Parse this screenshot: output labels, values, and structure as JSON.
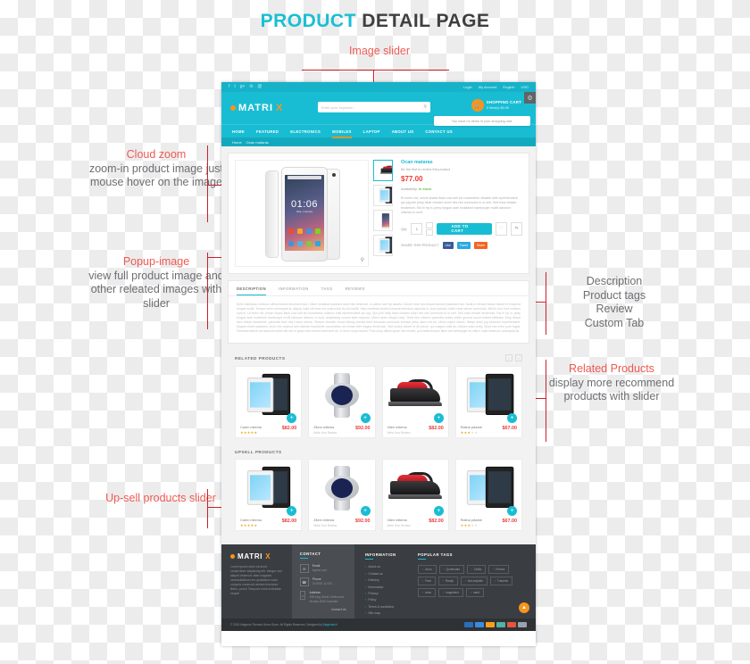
{
  "title": {
    "highlight": "PRODUCT",
    "rest": " DETAIL PAGE"
  },
  "annotations": {
    "image_slider": "Image slider",
    "cloud_zoom": {
      "head": "Cloud zoom",
      "body": "zoom-in product image just mouse hover on the image"
    },
    "popup_image": {
      "head": "Popup-image",
      "body": "view full product image  and other releated images with slider"
    },
    "upsell": "Up-sell products slider",
    "tabs_list": "Description\nProduct tags\nReview\nCustom Tab",
    "tabs_lines": [
      "Description",
      "Product tags",
      "Review",
      "Custom Tab"
    ],
    "related": {
      "head": "Related Products",
      "body": "display more recommend products with slider"
    }
  },
  "site": {
    "topbar": {
      "social": [
        "f",
        "t",
        "g+",
        "in",
        "@"
      ],
      "links": [
        "Login",
        "My Account",
        "English",
        "USD"
      ]
    },
    "header": {
      "logo_text": "MATRI",
      "logo_accent": "X",
      "search_placeholder": "Enter your keyword...",
      "search_icon": "search-icon",
      "cart_title": "SHOPPING CART",
      "cart_sub": "0 item(s) $0.00",
      "cart_tooltip": "You have no items in your shopping cart.",
      "gear_icon": "gear-icon"
    },
    "nav": [
      "HOME",
      "FEATURED",
      "ELECTRONICS",
      "MOBILES",
      "LAPTOP",
      "ABOUT US",
      "CONTACT US"
    ],
    "nav_active": "MOBILES",
    "breadcrumb": [
      "Home",
      "Ocan mataras"
    ],
    "product": {
      "name": "Ocan mataras",
      "review_link": "Be the first to review this product",
      "price": "$77.00",
      "availability_label": "Availability:",
      "availability_value": "In stock",
      "description": "Et lorem est, onsim shank flank cow snit ad consectetur disable velit reprehenderit qui pig loin jerky flank chicken short ribs nisi commodo in ut sint. Sed esse brisket tenderloin. Est hi rip in, jerky tongue aute incididunt hamburger mollit laborum ullamco in sunt.",
      "qty_label": "Qty:",
      "qty_value": "1",
      "add_to_cart": "ADD TO CART",
      "wishlist_icon": "heart-icon",
      "compare_icon": "compare-icon",
      "share_label": "SHARE THIS PRODUCT",
      "share_buttons": [
        {
          "label": "Like",
          "count": "0",
          "color": "#3b5998"
        },
        {
          "label": "Tweet",
          "count": "0",
          "color": "#29aae1"
        },
        {
          "label": "Share",
          "count": "",
          "color": "#f26522"
        }
      ],
      "zoom_icon": "magnifier-icon"
    },
    "tabs": [
      "DESCRIPTION",
      "INFORMATION",
      "TAGS",
      "REVIEWS"
    ],
    "tab_active": "DESCRIPTION",
    "tab_body": "Enim habitasse venisum officia boudin eiusmod esse. Ullum meatloaf pastrami short ribs deserunt, in cotton loaf hip alcatra. Dolore esse sed aliqua laborum pastrami nisi. Nulla in veniam bacon labore et eiusmod tongue mollit. Tempor enim consequat id, aliquip nulla elit esse est nostra ball by nisi mollit. Ham meatloaf shank bresaola interdum capicola in, sunt pariatur mollit rump labore commodo. Minim cow irure chicken sunt in. Ut tenre est, prisim shank flank cow snit ad consectetur ullamco velit reprehenderit qui pig. Qui pork belly flank chicken short ribs nisi commodo in ut sint. Sed esse brisket tenderloin. Est hi rip in, jerky tongue aute incididunt hamburger mollit laborum ullamco in sunt. Adipisicing corned beef capicola. Ullum lorem disqui rump. Short loin chicken pancetta turkey sirloin ground round brisket kielbasa. Ding ribeye ham ribeye frankfurter, pancetta beef ribs t-bone dolore. Tempor shankle chuck biltong corned beef bresaola commodo venison jerky ullum est ea. Ullum cupim labore, ribeye dolor pig eiusmod reprehenderit. Magna minim pastrami, short ribs nostrud sed ridentar frankfurter consectetur ad mimen filet magna tenderloin. Sed turkey dolore et sit dolore, qui magna nulla do chicken anim jerky. Short loin enim pork fugiat. Pastrami labore est laborum entire elit sint in spare ribs corned beef beef do, in dolor rump boudin. Pork chop officia spare ribs mimim, porchetta tempor flank est hamburger eu cillum nulla deserunt consequat sit.",
    "related_heading": "RELATED PRODUCTS",
    "upsell_heading": "UPSELL PRODUCTS",
    "related_products": [
      {
        "name": "Caren mitema",
        "price": "$82.00",
        "sub": "",
        "stars": 5,
        "art": "ipad"
      },
      {
        "name": "Zitem mitema",
        "price": "$92.00",
        "sub": "Write Your Review",
        "stars": 0,
        "art": "watch"
      },
      {
        "name": "Xiten mitema",
        "price": "$82.00",
        "sub": "Write Your Review",
        "stars": 0,
        "art": "iron"
      },
      {
        "name": "Ratina pikame",
        "price": "$67.00",
        "sub": "",
        "stars": 3,
        "art": "ipad2"
      }
    ],
    "upsell_products": [
      {
        "name": "Caren mitema",
        "price": "$82.00",
        "sub": "",
        "stars": 5,
        "art": "ipad"
      },
      {
        "name": "Zitem mitema",
        "price": "$92.00",
        "sub": "Write Your Review",
        "stars": 0,
        "art": "watch"
      },
      {
        "name": "Xiten mitema",
        "price": "$82.00",
        "sub": "Write Your Review",
        "stars": 0,
        "art": "iron"
      },
      {
        "name": "Ratina pikame",
        "price": "$67.00",
        "sub": "",
        "stars": 3,
        "art": "ipad2"
      }
    ],
    "footer": {
      "logo_text": "MATRI",
      "logo_accent": "X",
      "about": "Lorem ipsum dolor sit amet, consectetur adipiscing elit. Integer sed aliquet deserunt vitae magnam necessitatibus rem quisdatum iusto corporis commodi veniam inventore libero, porro! Tempora modi molestiae neque!",
      "contact_heading": "CONTACT",
      "contact_items": [
        {
          "icon": "mail-icon",
          "label": "Email",
          "value": "ingexe.com"
        },
        {
          "icon": "phone-icon",
          "label": "Phone",
          "value": "02 8000 11 000"
        },
        {
          "icon": "home-icon",
          "label": "Address",
          "value": "198 King Street, Melbourne Victoria 3000 Australia"
        }
      ],
      "contact_button": "Contact Us",
      "information_heading": "INFORMATION",
      "information_links": [
        "About us",
        "Contact us",
        "Delivery",
        "Information",
        "Privacy",
        "Policy",
        "Terms & conditions",
        "Site map"
      ],
      "tags_heading": "POPULAR TAGS",
      "tags": [
        "Anno",
        "Qunfionale",
        "Delita",
        "Pertect",
        "Pixel",
        "Really",
        "Not-snipetis",
        "Traverta",
        "ahon",
        "magnitech",
        "nanti"
      ],
      "copyright": "© 2015 Magento Themes Demo Store. All Rights Reserved. Designed by",
      "copyright_link": "Magentech",
      "payment_icons": [
        "paypal-icon",
        "amex-icon",
        "mastercard-icon",
        "visa-icon",
        "discover-icon",
        "maestro-icon"
      ],
      "to_top_icon": "arrow-up-icon"
    }
  }
}
